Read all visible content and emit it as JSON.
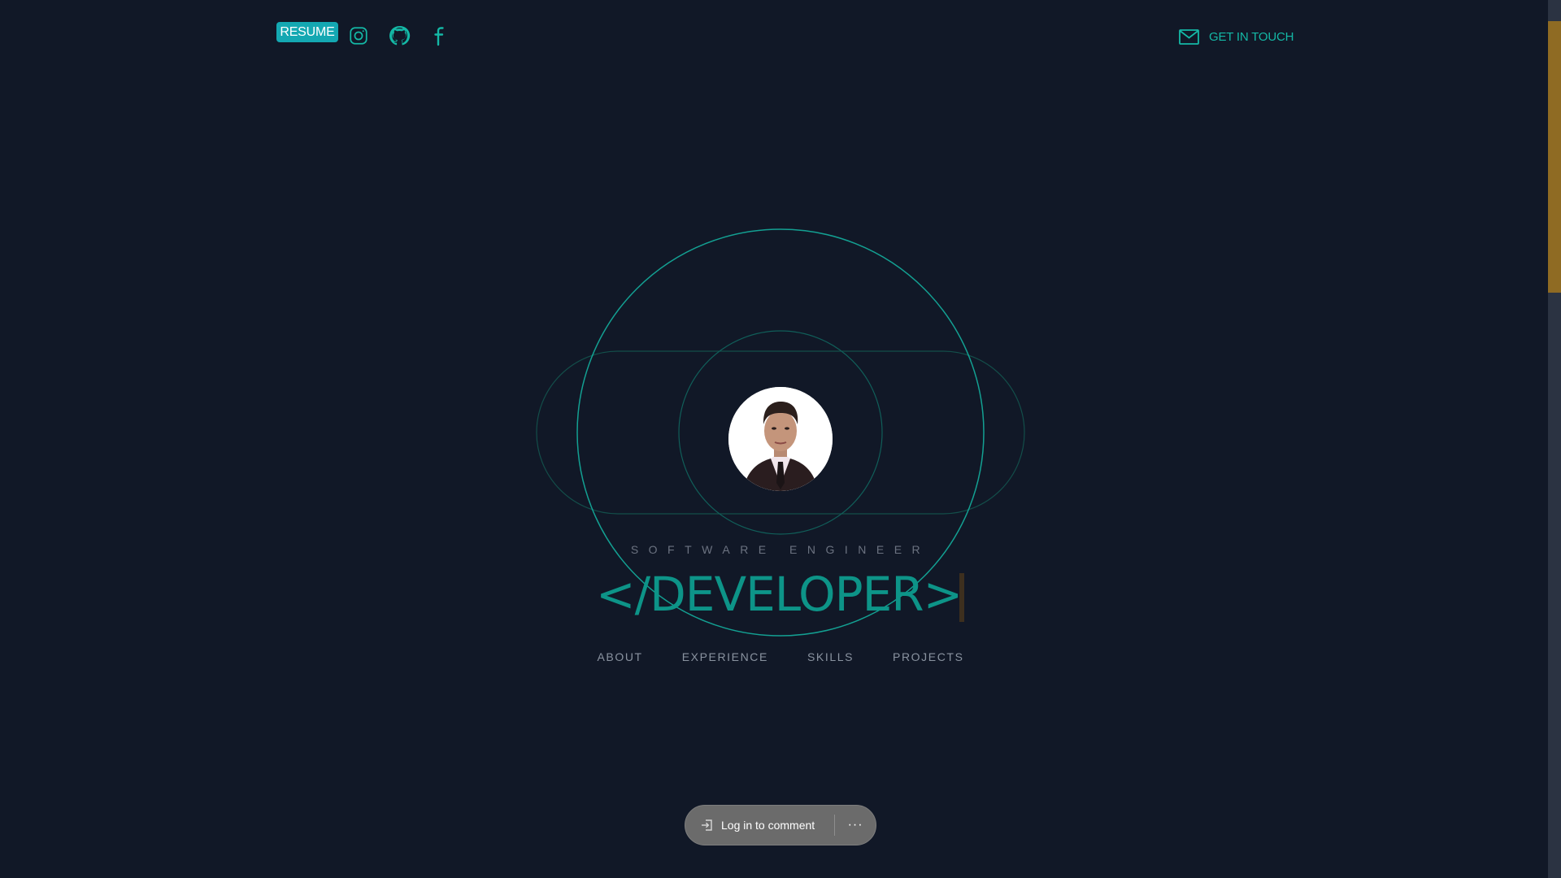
{
  "header": {
    "resume_label": "RESUME",
    "social_icons": [
      "instagram-icon",
      "github-icon",
      "facebook-icon"
    ],
    "contact_label": "GET IN TOUCH",
    "contact_icon": "mail-icon"
  },
  "hero": {
    "subtitle": "SOFTWARE ENGINEER",
    "headline": "</DEVELOPER>",
    "avatar": "profile-photo"
  },
  "nav": {
    "items": [
      {
        "label": "ABOUT"
      },
      {
        "label": "EXPERIENCE"
      },
      {
        "label": "SKILLS"
      },
      {
        "label": "PROJECTS"
      }
    ]
  },
  "comment_bar": {
    "login_label": "Log in to comment",
    "more_label": "···",
    "login_icon": "login-arrow-icon"
  },
  "colors": {
    "background": "#111827",
    "accent": "#14b8a6",
    "resume_bg": "#14a8b2",
    "headline": "#0d9488",
    "muted_text": "#6b7280",
    "scroll_thumb": "#8f6b23"
  }
}
